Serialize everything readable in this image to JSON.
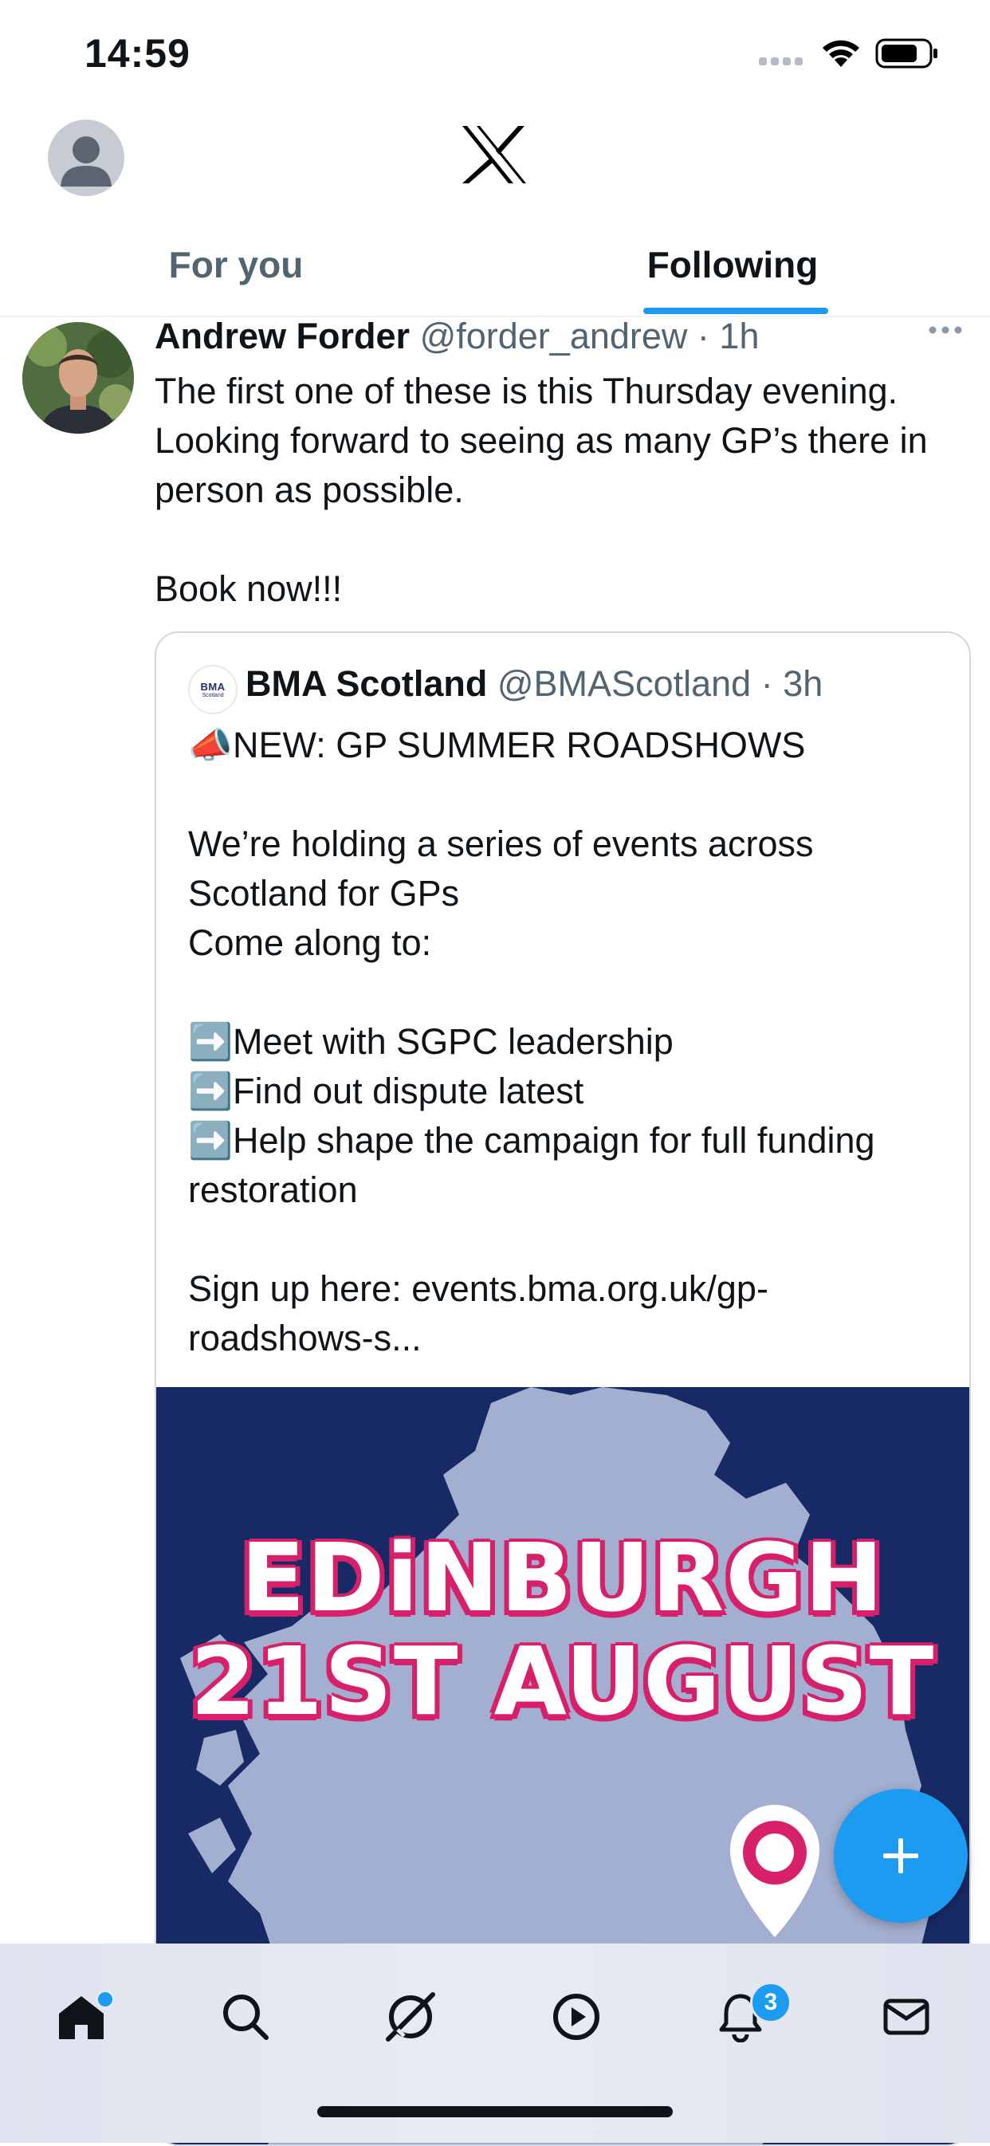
{
  "status_bar": {
    "time": "14:59"
  },
  "header": {
    "logo": "x-logo-icon"
  },
  "tabs": [
    {
      "label": "For you",
      "selected": false
    },
    {
      "label": "Following",
      "selected": true
    }
  ],
  "tweet": {
    "author_name": "Andrew Forder",
    "handle": "@forder_andrew",
    "separator": " · ",
    "time": "1h",
    "text": "The first one of these is this Thursday evening. Looking forward to seeing as many GP’s there in person as possible.\n\nBook now!!!",
    "quote": {
      "avatar_text": "BMA",
      "avatar_subtext": "Scotland",
      "author_name": "BMA Scotland",
      "handle": "@BMAScotland",
      "separator": " · ",
      "time": "3h",
      "text": "📣NEW: GP SUMMER ROADSHOWS\n\nWe’re holding a series of events across Scotland for GPs\nCome along to:\n\n➡️Meet with SGPC leadership\n➡️Find out dispute latest\n➡️Help shape the campaign for full funding restoration\n\nSign up here: events.bma.org.uk/gp-roadshows-s...",
      "image": {
        "line1": "EDiNBURGH",
        "line2": "21ST AUGUST",
        "background_color": "#182a66",
        "map_color": "#a3afd1"
      }
    }
  },
  "bottom_nav": {
    "items": [
      "home-icon",
      "search-icon",
      "grok-icon",
      "video-icon",
      "bell-icon",
      "mail-icon"
    ],
    "notifications_badge": "3"
  },
  "colors": {
    "accent": "#1d9bf0",
    "text": "#0f1419",
    "muted": "#536471"
  }
}
